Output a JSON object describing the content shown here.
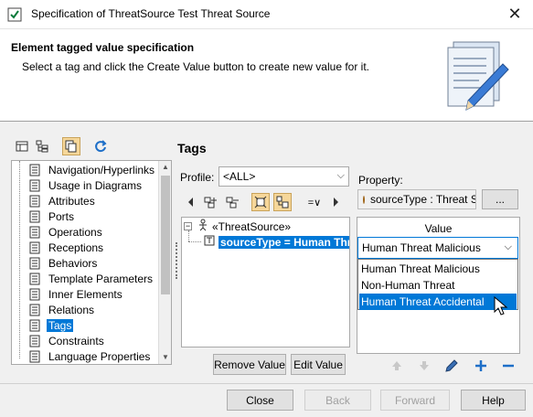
{
  "window": {
    "title": "Specification of ThreatSource Test Threat Source",
    "close_glyph": "✕"
  },
  "header": {
    "title": "Element tagged value specification",
    "description": "Select a tag and click the Create Value button to create new value for it."
  },
  "left_panel": {
    "items": [
      {
        "label": "Navigation/Hyperlinks",
        "selected": false
      },
      {
        "label": "Usage in Diagrams",
        "selected": false
      },
      {
        "label": "Attributes",
        "selected": false
      },
      {
        "label": "Ports",
        "selected": false
      },
      {
        "label": "Operations",
        "selected": false
      },
      {
        "label": "Receptions",
        "selected": false
      },
      {
        "label": "Behaviors",
        "selected": false
      },
      {
        "label": "Template Parameters",
        "selected": false
      },
      {
        "label": "Inner Elements",
        "selected": false
      },
      {
        "label": "Relations",
        "selected": false
      },
      {
        "label": "Tags",
        "selected": true
      },
      {
        "label": "Constraints",
        "selected": false
      },
      {
        "label": "Language Properties",
        "selected": false
      }
    ]
  },
  "tags": {
    "title": "Tags",
    "profile_label": "Profile:",
    "profile_value": "<ALL>",
    "tree": {
      "stereotype": "«ThreatSource»",
      "selected_tag": "sourceType = Human Threat Accidental"
    },
    "remove_value_label": "Remove Value",
    "edit_value_label": "Edit Value"
  },
  "property": {
    "label": "Property:",
    "value": "sourceType : Threat Source Type",
    "browse_label": "..."
  },
  "value_table": {
    "header": "Value",
    "current_value": "Human Threat Malicious",
    "options": [
      {
        "label": "Human Threat Malicious",
        "selected": false
      },
      {
        "label": "Non-Human Threat",
        "selected": false
      },
      {
        "label": "Human Threat Accidental",
        "selected": true
      }
    ]
  },
  "footer": {
    "close": "Close",
    "back": "Back",
    "forward": "Forward",
    "help": "Help"
  },
  "colors": {
    "selection": "#0078d7",
    "pressed_toolbar": "#f6d79a"
  }
}
